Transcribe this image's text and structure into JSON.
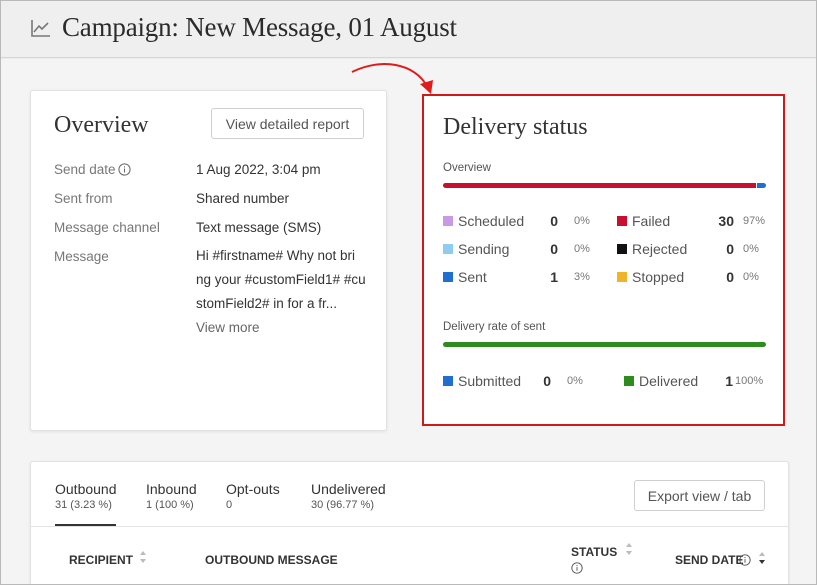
{
  "header": {
    "title": "Campaign: New Message, 01 August",
    "icon": "line-chart-icon"
  },
  "overview": {
    "title": "Overview",
    "view_report_label": "View detailed report",
    "rows": [
      {
        "label": "Send date",
        "value": "1 Aug 2022, 3:04 pm"
      },
      {
        "label": "Sent from",
        "value": "Shared number"
      },
      {
        "label": "Message channel",
        "value": "Text message (SMS)"
      },
      {
        "label": "Message",
        "value": ""
      }
    ],
    "message_lines": [
      "Hi #firstname# Why not bri",
      "ng your #customField1# #cu",
      "stomField2# in for a fr..."
    ],
    "view_more_label": "View more"
  },
  "delivery": {
    "title": "Delivery status",
    "overview_label": "Overview",
    "stats_left": [
      {
        "label": "Scheduled",
        "count": "0",
        "pct": "0%",
        "color": "#c89ae6"
      },
      {
        "label": "Sending",
        "count": "0",
        "pct": "0%",
        "color": "#8ecdf0"
      },
      {
        "label": "Sent",
        "count": "1",
        "pct": "3%",
        "color": "#1f6fd1"
      }
    ],
    "stats_right": [
      {
        "label": "Failed",
        "count": "30",
        "pct": "97%",
        "color": "#c8102e"
      },
      {
        "label": "Rejected",
        "count": "0",
        "pct": "0%",
        "color": "#111111"
      },
      {
        "label": "Stopped",
        "count": "0",
        "pct": "0%",
        "color": "#f0b429"
      }
    ],
    "rate_label": "Delivery rate of sent",
    "rate_stats": [
      {
        "label": "Submitted",
        "count": "0",
        "pct": "0%",
        "color": "#1f6fd1"
      },
      {
        "label": "Delivered",
        "count": "1",
        "pct": "100%",
        "color": "#2e8b1e"
      }
    ]
  },
  "chart_data": [
    {
      "type": "bar",
      "categories": [
        "Failed",
        "Sent"
      ],
      "values": [
        30,
        1
      ],
      "colors": [
        "#c8102e",
        "#1f6fd1"
      ],
      "stacked": true,
      "orientation": "horizontal",
      "title": "Overview"
    },
    {
      "type": "bar",
      "categories": [
        "Delivered",
        "Submitted"
      ],
      "values": [
        1,
        0
      ],
      "colors": [
        "#2e8b1e",
        "#1f6fd1"
      ],
      "stacked": true,
      "orientation": "horizontal",
      "title": "Delivery rate of sent"
    }
  ],
  "tabs": [
    {
      "label": "Outbound",
      "sub": "31 (3.23 %)"
    },
    {
      "label": "Inbound",
      "sub": "1 (100 %)"
    },
    {
      "label": "Opt-outs",
      "sub": "0"
    },
    {
      "label": "Undelivered",
      "sub": "30 (96.77 %)"
    }
  ],
  "export_label": "Export view / tab",
  "table_headers": {
    "recipient": "RECIPIENT",
    "message": "OUTBOUND MESSAGE",
    "status": "STATUS",
    "send_date": "SEND DATE"
  }
}
